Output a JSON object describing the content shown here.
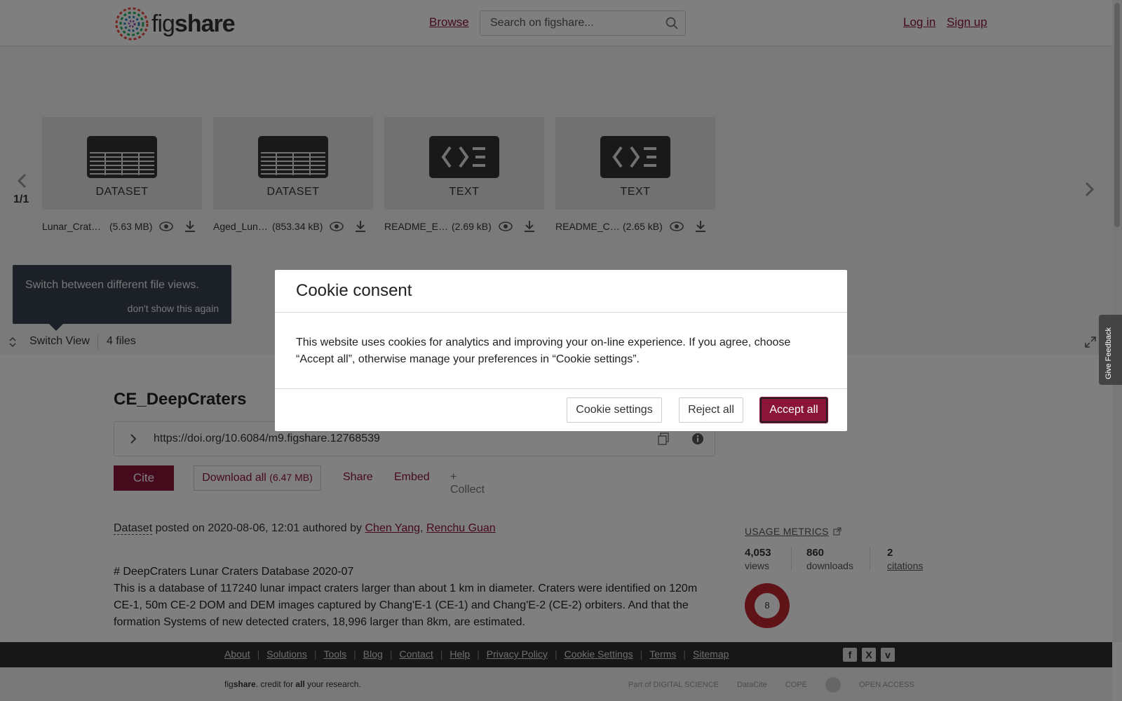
{
  "header": {
    "logo_text_light": "fig",
    "logo_text_bold": "share",
    "browse": "Browse",
    "search_placeholder": "Search on figshare...",
    "login": "Log in",
    "signup": "Sign up"
  },
  "carousel": {
    "counter": "1/1",
    "files": [
      {
        "type": "DATASET",
        "icon": "table-icon",
        "name": "Lunar_Crat…",
        "size": "(5.63 MB)"
      },
      {
        "type": "DATASET",
        "icon": "table-icon",
        "name": "Aged_Lun…",
        "size": "(853.34 kB)"
      },
      {
        "type": "TEXT",
        "icon": "code-icon",
        "name": "README_E…",
        "size": "(2.69 kB)"
      },
      {
        "type": "TEXT",
        "icon": "code-icon",
        "name": "README_C…",
        "size": "(2.65 kB)"
      }
    ],
    "tooltip_text": "Switch between different file views.",
    "tooltip_dismiss": "don't show this again",
    "switch_view": "Switch View",
    "file_count": "4 files"
  },
  "item": {
    "title": "CE_DeepCraters",
    "doi": "https://doi.org/10.6084/m9.figshare.12768539",
    "cite": "Cite",
    "download_all": "Download all",
    "download_size": "(6.47 MB)",
    "share": "Share",
    "embed": "Embed",
    "collect": "+ Collect",
    "type_label": "Dataset",
    "posted_text": " posted on 2020-08-06, 12:01 authored by ",
    "author1": "Chen Yang",
    "author_sep": ", ",
    "author2": "Renchu Guan",
    "desc_heading": "# DeepCraters Lunar Craters Database 2020-07",
    "desc_body": "This is a database of 117240 lunar impact craters larger than about 1 km in diameter. Craters were identified on 120m CE-1, 50m CE-2 DOM and DEM images captured by Chang'E-1 (CE-1) and Chang'E-2 (CE-2) orbiters. And that the formation Systems of new detected craters, 18,996 larger than 8km, are estimated."
  },
  "metrics": {
    "title": "USAGE METRICS",
    "views_num": "4,053",
    "views_lbl": "views",
    "downloads_num": "860",
    "downloads_lbl": "downloads",
    "citations_num": "2",
    "citations_lbl": "citations",
    "altmetric_score": "8"
  },
  "footer": {
    "links": [
      "About",
      "Solutions",
      "Tools",
      "Blog",
      "Contact",
      "Help",
      "Privacy Policy",
      "Cookie Settings",
      "Terms",
      "Sitemap"
    ],
    "tagline_brand_light": "fig",
    "tagline_brand_bold": "share",
    "tagline_mid": ". credit for ",
    "tagline_bold": "all",
    "tagline_end": " your research.",
    "partner_digital_science": "Part of DIGITAL SCIENCE",
    "partner_datacite": "DataCite",
    "partner_cope": "COPE",
    "partner_open_access": "OPEN ACCESS",
    "feedback": "Give Feedback"
  },
  "cookie": {
    "title": "Cookie consent",
    "body": "This website uses cookies for analytics and improving your on-line experience. If you agree, choose “Accept all”, otherwise manage your preferences in “Cookie settings”.",
    "settings": "Cookie settings",
    "reject": "Reject all",
    "accept": "Accept all"
  },
  "colors": {
    "brand": "#8a1538",
    "altmetric": "#c1272d",
    "footer_bg": "#2e2e2e"
  }
}
